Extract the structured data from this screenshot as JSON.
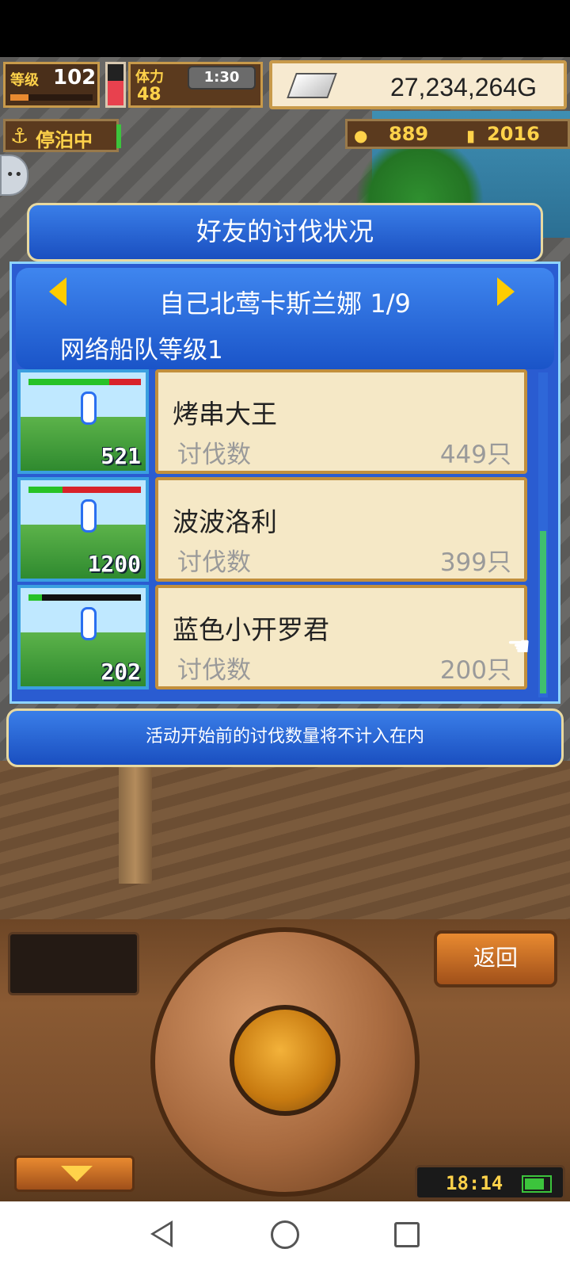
{
  "hud": {
    "level_label": "等级",
    "level_value": "102",
    "level_progress_pct": 22,
    "stamina_label": "体力",
    "stamina_value": "48",
    "stamina_fill_pct": 60,
    "timer": "1:30",
    "gold": "27,234,264G"
  },
  "status": {
    "anchor_text": "停泊中",
    "resource1": "889",
    "resource2": "2016"
  },
  "dialog": {
    "title": "好友的讨伐状况",
    "friend_name": "自己北莺卡斯兰娜 1/9",
    "fleet_level": "网络船队等级1",
    "rows": [
      {
        "thumb_number": "521",
        "hp_pct": 72,
        "name": "烤串大王",
        "label": "讨伐数",
        "count": "449只"
      },
      {
        "thumb_number": "1200",
        "hp_pct": 30,
        "name": "波波洛利",
        "label": "讨伐数",
        "count": "399只"
      },
      {
        "thumb_number": "202",
        "hp_pct": 12,
        "name": "蓝色小开罗君",
        "label": "讨伐数",
        "count": "200只"
      }
    ],
    "note": "活动开始前的讨伐数量将不计入在内"
  },
  "controls": {
    "back_label": "返回",
    "clock": "18:14"
  },
  "colors": {
    "dialog_blue": "#2a5cd1",
    "card_bg": "#f5e8c6",
    "accent_gold": "#ffd24a"
  }
}
